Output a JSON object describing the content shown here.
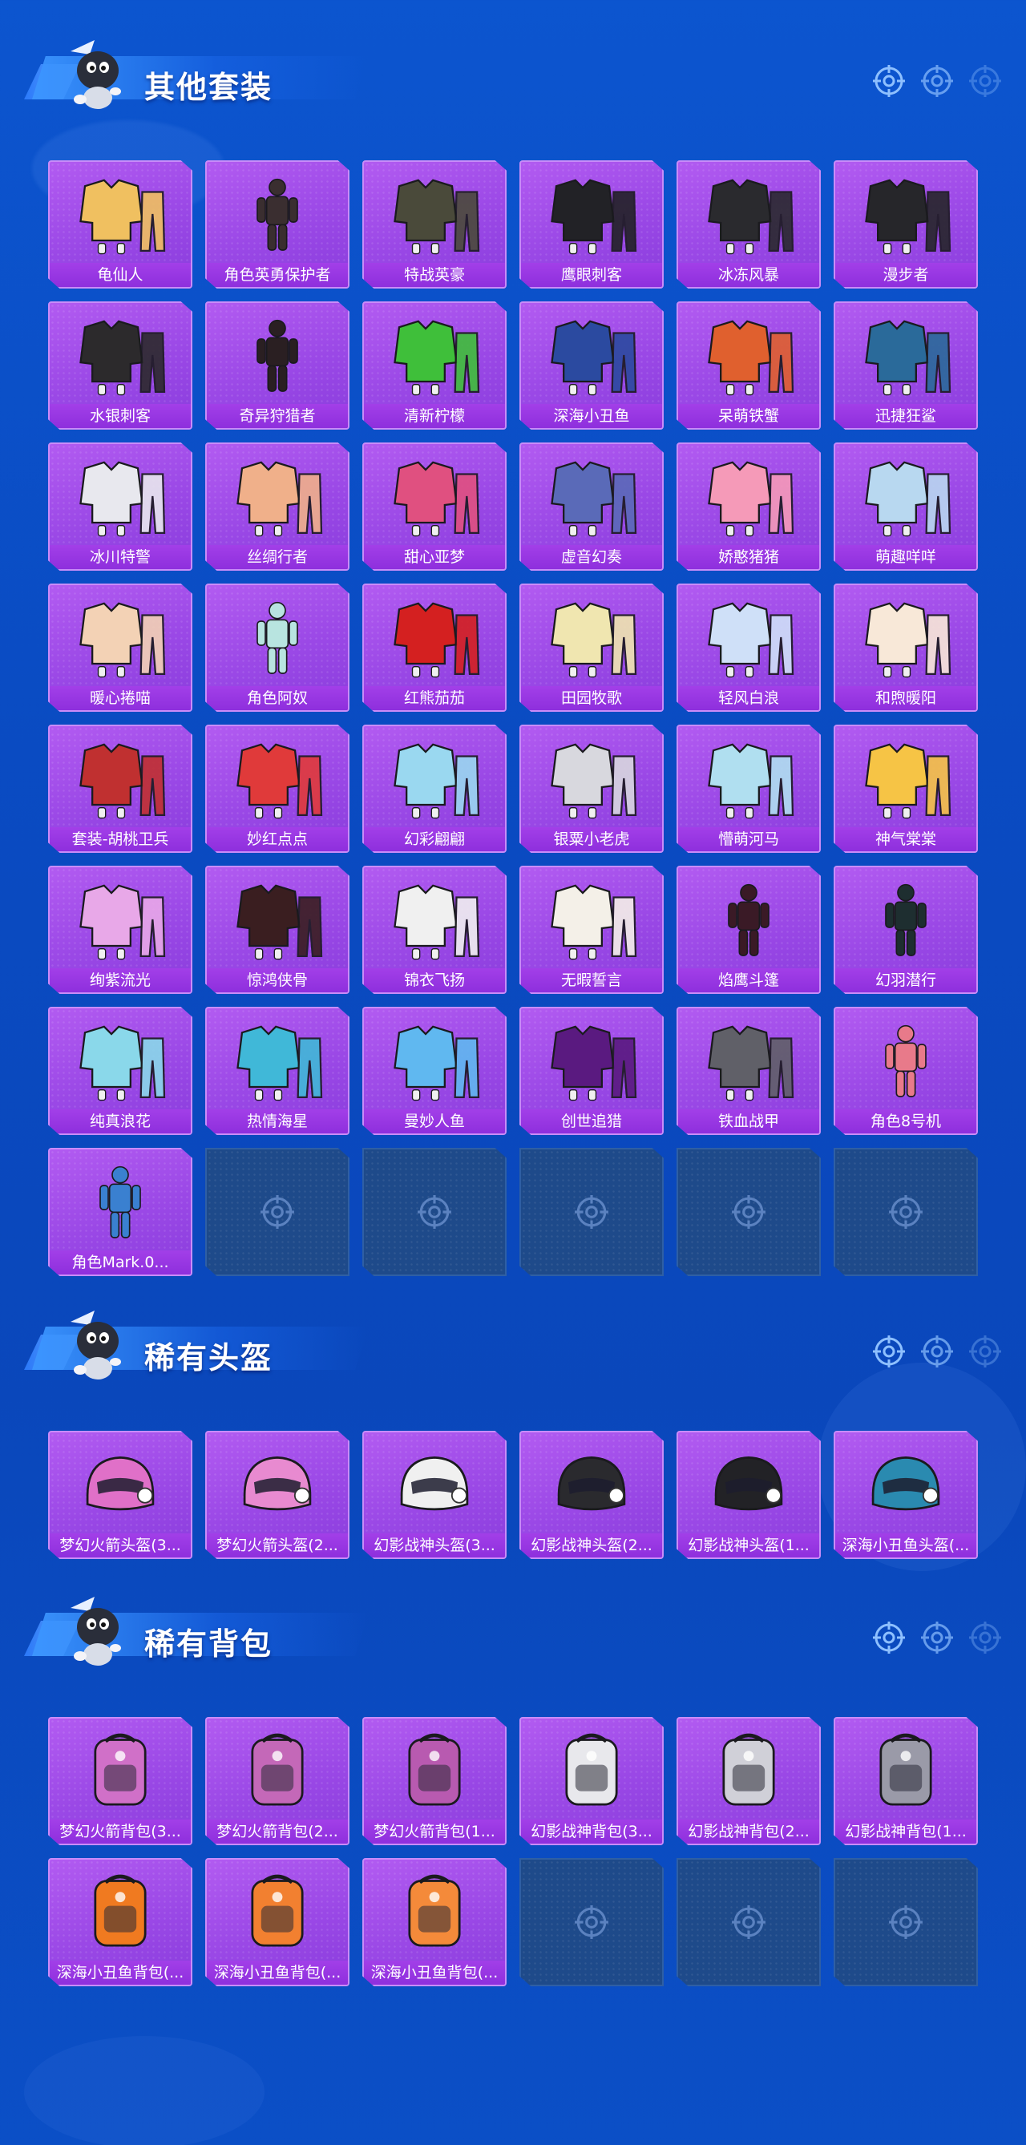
{
  "sections": [
    {
      "title": "其他套装",
      "items": [
        {
          "label": "龟仙人",
          "icon": "outfit-shirt",
          "color": "#f0c060"
        },
        {
          "label": "角色英勇保护者",
          "icon": "armor-figure",
          "color": "#3a2e30"
        },
        {
          "label": "特战英豪",
          "icon": "tactical-outfit",
          "color": "#4a4a3a"
        },
        {
          "label": "鹰眼刺客",
          "icon": "dark-outfit",
          "color": "#222226"
        },
        {
          "label": "冰冻风暴",
          "icon": "dark-outfit",
          "color": "#2a2a2e"
        },
        {
          "label": "漫步者",
          "icon": "dark-outfit",
          "color": "#26262a"
        },
        {
          "label": "水银刺客",
          "icon": "dark-outfit",
          "color": "#2c2a2c"
        },
        {
          "label": "奇异狩猎者",
          "icon": "hooded-figure",
          "color": "#2a1f22"
        },
        {
          "label": "清新柠檬",
          "icon": "green-outfit",
          "color": "#3fbf3a"
        },
        {
          "label": "深海小丑鱼",
          "icon": "colorful-outfit",
          "color": "#2b4aa0"
        },
        {
          "label": "呆萌铁蟹",
          "icon": "crab-outfit",
          "color": "#e0602e"
        },
        {
          "label": "迅捷狂鲨",
          "icon": "shark-outfit",
          "color": "#2a6a9a"
        },
        {
          "label": "冰川特警",
          "icon": "white-outfit",
          "color": "#e8e8ee"
        },
        {
          "label": "丝绸行者",
          "icon": "silk-outfit",
          "color": "#f0b08a"
        },
        {
          "label": "甜心亚梦",
          "icon": "dress-outfit",
          "color": "#e05080"
        },
        {
          "label": "虚音幻奏",
          "icon": "stage-outfit",
          "color": "#5a6ab8"
        },
        {
          "label": "娇憨猪猪",
          "icon": "pink-outfit",
          "color": "#f59ab8"
        },
        {
          "label": "萌趣咩咩",
          "icon": "light-outfit",
          "color": "#b8d8f0"
        },
        {
          "label": "暖心捲喵",
          "icon": "cat-outfit",
          "color": "#f3d2b5"
        },
        {
          "label": "角色阿奴",
          "icon": "girl-figure",
          "color": "#b8e4e0"
        },
        {
          "label": "红熊茄茄",
          "icon": "red-outfit",
          "color": "#d42020"
        },
        {
          "label": "田园牧歌",
          "icon": "pastoral-outfit",
          "color": "#f0e6b0"
        },
        {
          "label": "轻风白浪",
          "icon": "light-outfit",
          "color": "#cfe0f8"
        },
        {
          "label": "和煦暖阳",
          "icon": "sun-outfit",
          "color": "#f8e8d8"
        },
        {
          "label": "套装-胡桃卫兵",
          "icon": "nutcracker-outfit",
          "color": "#c03030"
        },
        {
          "label": "妙红点点",
          "icon": "red-dress",
          "color": "#e03a3a"
        },
        {
          "label": "幻彩翩翩",
          "icon": "pastel-outfit",
          "color": "#9ad8f0"
        },
        {
          "label": "银粟小老虎",
          "icon": "tiger-outfit",
          "color": "#d8d8de"
        },
        {
          "label": "懵萌河马",
          "icon": "light-outfit",
          "color": "#b0dff0"
        },
        {
          "label": "神气棠棠",
          "icon": "yellow-outfit",
          "color": "#f6c445"
        },
        {
          "label": "绚紫流光",
          "icon": "purple-outfit",
          "color": "#e8a8e8"
        },
        {
          "label": "惊鸿侠骨",
          "icon": "warrior-outfit",
          "color": "#3a1e20"
        },
        {
          "label": "锦衣飞扬",
          "icon": "white-robe",
          "color": "#f0f0f0"
        },
        {
          "label": "无暇誓言",
          "icon": "wedding-outfit",
          "color": "#f4f0e8"
        },
        {
          "label": "焰鹰斗篷",
          "icon": "cloak-figure",
          "color": "#3a1a26"
        },
        {
          "label": "幻羽潜行",
          "icon": "stealth-figure",
          "color": "#1e2e30"
        },
        {
          "label": "纯真浪花",
          "icon": "wave-outfit",
          "color": "#8ad8ea"
        },
        {
          "label": "热情海星",
          "icon": "starfish-outfit",
          "color": "#40b8d8"
        },
        {
          "label": "曼妙人鱼",
          "icon": "mermaid-outfit",
          "color": "#60b8f0"
        },
        {
          "label": "创世追猎",
          "icon": "neon-suit",
          "color": "#5a1a80"
        },
        {
          "label": "铁血战甲",
          "icon": "armor-suit",
          "color": "#606068"
        },
        {
          "label": "角色8号机",
          "icon": "mecha-figure",
          "color": "#e87a8a"
        },
        {
          "label": "角色Mark.0...",
          "icon": "mecha-figure",
          "color": "#3a80d0"
        }
      ],
      "empty_slots": 5
    },
    {
      "title": "稀有头盔",
      "items": [
        {
          "label": "梦幻火箭头盔(3...",
          "icon": "helmet",
          "color": "#e070c8"
        },
        {
          "label": "梦幻火箭头盔(2...",
          "icon": "helmet",
          "color": "#e88ad0"
        },
        {
          "label": "幻影战神头盔(3...",
          "icon": "helmet",
          "color": "#f0f0f0"
        },
        {
          "label": "幻影战神头盔(2...",
          "icon": "helmet",
          "color": "#2a2a2e"
        },
        {
          "label": "幻影战神头盔(1...",
          "icon": "helmet",
          "color": "#222226"
        },
        {
          "label": "深海小丑鱼头盔(...",
          "icon": "helmet",
          "color": "#2a8ab0"
        }
      ],
      "empty_slots": 0
    },
    {
      "title": "稀有背包",
      "items": [
        {
          "label": "梦幻火箭背包(3...",
          "icon": "backpack",
          "color": "#d070c8"
        },
        {
          "label": "梦幻火箭背包(2...",
          "icon": "backpack",
          "color": "#c468b8"
        },
        {
          "label": "梦幻火箭背包(1...",
          "icon": "backpack",
          "color": "#b85ab0"
        },
        {
          "label": "幻影战神背包(3...",
          "icon": "backpack",
          "color": "#e8e8ec"
        },
        {
          "label": "幻影战神背包(2...",
          "icon": "backpack",
          "color": "#d0d0d8"
        },
        {
          "label": "幻影战神背包(1...",
          "icon": "backpack",
          "color": "#9a9aa8"
        },
        {
          "label": "深海小丑鱼背包(...",
          "icon": "backpack",
          "color": "#f07a20"
        },
        {
          "label": "深海小丑鱼背包(...",
          "icon": "backpack",
          "color": "#f28030"
        },
        {
          "label": "深海小丑鱼背包(...",
          "icon": "backpack",
          "color": "#f48a3a"
        }
      ],
      "empty_slots": 3
    }
  ]
}
